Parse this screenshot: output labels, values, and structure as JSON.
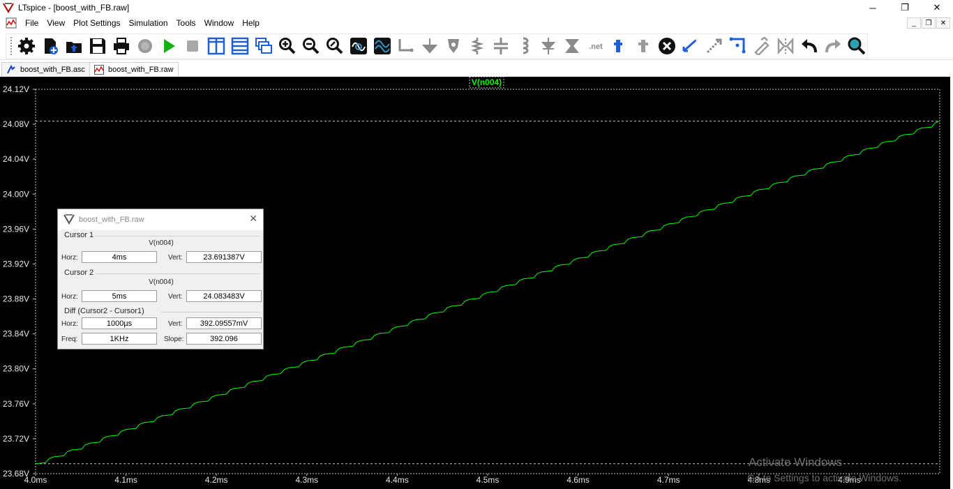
{
  "window": {
    "title": "LTspice - [boost_with_FB.raw]",
    "min_label": "─",
    "max_label": "❐",
    "close_label": "✕"
  },
  "menu": {
    "items": [
      "File",
      "View",
      "Plot Settings",
      "Simulation",
      "Tools",
      "Window",
      "Help"
    ],
    "mdi_min": "_",
    "mdi_restore": "❐",
    "mdi_close": "✕"
  },
  "toolbar": {
    "buttons": [
      "settings-icon",
      "new-schematic-icon",
      "open-icon",
      "save-icon",
      "print-icon",
      "halt-icon",
      "run-icon",
      "stop-icon",
      "tile-vertical-icon",
      "tile-horizontal-icon",
      "cascade-icon",
      "zoom-in-icon",
      "zoom-out-icon",
      "zoom-fit-icon",
      "autorange-icon",
      "waveform-icon",
      "wire-icon",
      "ground-icon",
      "label-icon",
      "resistor-icon",
      "capacitor-icon",
      "inductor-icon",
      "diode-icon",
      "component-icon",
      "spice-directive-icon",
      "text-icon",
      "move-icon",
      "delete-icon",
      "duplicate-icon",
      "move-drag-icon",
      "drag-icon",
      "rotate-icon",
      "mirror-icon",
      "undo-icon",
      "redo-icon",
      "find-icon"
    ]
  },
  "tabs": [
    {
      "label": "boost_with_FB.asc",
      "icon": "schematic-icon"
    },
    {
      "label": "boost_with_FB.raw",
      "icon": "waveform-icon"
    }
  ],
  "plot": {
    "trace_label": "V(n004)",
    "bg_color": "#000000",
    "trace_color": "#00ff00",
    "cursor_color": "#c8c8c8"
  },
  "chart_data": {
    "type": "line",
    "series": [
      {
        "name": "V(n004)",
        "start": {
          "x": 4.0,
          "y": 23.6914
        },
        "end": {
          "x": 5.0,
          "y": 24.0835
        },
        "ripple_period_ms": 0.02
      }
    ],
    "xlabel": "",
    "ylabel": "",
    "x_ticks": [
      "4.0ms",
      "4.1ms",
      "4.2ms",
      "4.3ms",
      "4.4ms",
      "4.5ms",
      "4.6ms",
      "4.7ms",
      "4.8ms",
      "4.9ms"
    ],
    "y_ticks": [
      "24.12V",
      "24.08V",
      "24.04V",
      "24.00V",
      "23.96V",
      "23.92V",
      "23.88V",
      "23.84V",
      "23.80V",
      "23.76V",
      "23.72V",
      "23.68V"
    ],
    "xlim": [
      4.0,
      5.0
    ],
    "ylim": [
      23.68,
      24.12
    ],
    "grid": false,
    "cursors": [
      {
        "x": 4.0,
        "y": 23.691387
      },
      {
        "x": 5.0,
        "y": 24.083483
      }
    ]
  },
  "cursor_dialog": {
    "title": "boost_with_FB.raw",
    "close": "✕",
    "cursor1": {
      "group": "Cursor 1",
      "trace": "V(n004)",
      "horz_label": "Horz:",
      "horz": "4ms",
      "vert_label": "Vert:",
      "vert": "23.691387V"
    },
    "cursor2": {
      "group": "Cursor 2",
      "trace": "V(n004)",
      "horz_label": "Horz:",
      "horz": "5ms",
      "vert_label": "Vert:",
      "vert": "24.083483V"
    },
    "diff": {
      "group": "Diff (Cursor2 - Cursor1)",
      "horz_label": "Horz:",
      "horz": "1000µs",
      "vert_label": "Vert:",
      "vert": "392.09557mV",
      "freq_label": "Freq:",
      "freq": "1KHz",
      "slope_label": "Slope:",
      "slope": "392.096"
    }
  },
  "watermark": {
    "line1": "Activate Windows",
    "line2": "Go to Settings to activate Windows."
  }
}
